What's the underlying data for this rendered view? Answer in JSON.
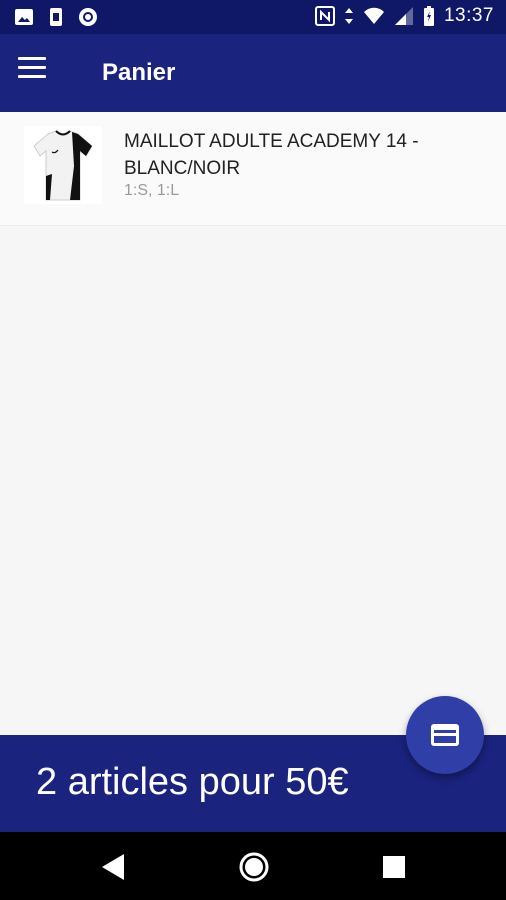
{
  "status_bar": {
    "time": "13:37",
    "icons": [
      "image-icon",
      "sim-icon",
      "circle-app-icon",
      "nfc-icon",
      "data-arrows-icon",
      "wifi-icon",
      "signal-icon",
      "battery-icon"
    ]
  },
  "app_bar": {
    "title": "Panier",
    "menu_icon": "hamburger-menu-icon"
  },
  "cart": {
    "items": [
      {
        "name": "MAILLOT ADULTE ACADEMY 14 - BLANC/NOIR",
        "sizes": "1:S, 1:L",
        "image": "jersey-thumbnail"
      }
    ]
  },
  "footer": {
    "summary": "2 articles pour 50€"
  },
  "fab": {
    "icon": "credit-card-icon"
  },
  "nav_bar": {
    "icons": [
      "back-icon",
      "home-icon",
      "recents-icon"
    ]
  },
  "colors": {
    "status_bar": "#0f1866",
    "primary": "#1a237e",
    "fab": "#303fa8",
    "background": "#f6f6f7"
  }
}
